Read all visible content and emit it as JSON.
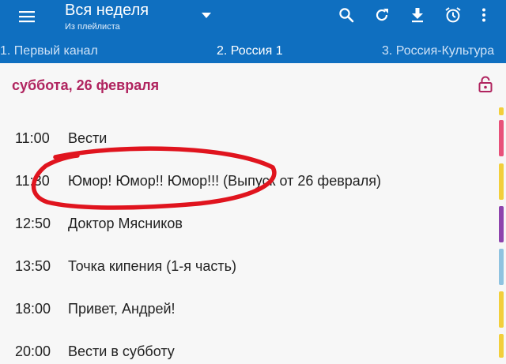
{
  "header": {
    "title": "Вся неделя",
    "subtitle": "Из плейлиста"
  },
  "icons": {
    "menu": "hamburger-icon",
    "dropdown": "dropdown-arrow-icon",
    "search": "search-icon",
    "refresh": "refresh-icon",
    "download": "download-icon",
    "alarm": "alarm-clock-icon",
    "more": "more-vert-icon",
    "lock": "lock-open-icon"
  },
  "tabs": [
    {
      "label": "1. Первый канал",
      "active": false
    },
    {
      "label": "2. Россия 1",
      "active": true
    },
    {
      "label": "3. Россия-Культура",
      "active": false
    }
  ],
  "schedule": {
    "date": "суббота, 26 февраля",
    "programs": [
      {
        "time": "11:00",
        "title": "Вести"
      },
      {
        "time": "11:30",
        "title": "Юмор! Юмор!! Юмор!!! (Выпуск от 26 февраля)"
      },
      {
        "time": "12:50",
        "title": "Доктор Мясников"
      },
      {
        "time": "13:50",
        "title": "Точка кипения (1-я часть)"
      },
      {
        "time": "18:00",
        "title": "Привет, Андрей!"
      },
      {
        "time": "20:00",
        "title": "Вести в субботу"
      }
    ]
  },
  "colors": {
    "appbar": "#0f6fc0",
    "date_text": "#b0245f",
    "annotation": "#e0141e",
    "category_bars": [
      "#f2cf3b",
      "#e8517a",
      "#f2cf3b",
      "#8e44ad",
      "#8fc3e0",
      "#f2cf3b",
      "#f2cf3b"
    ]
  }
}
